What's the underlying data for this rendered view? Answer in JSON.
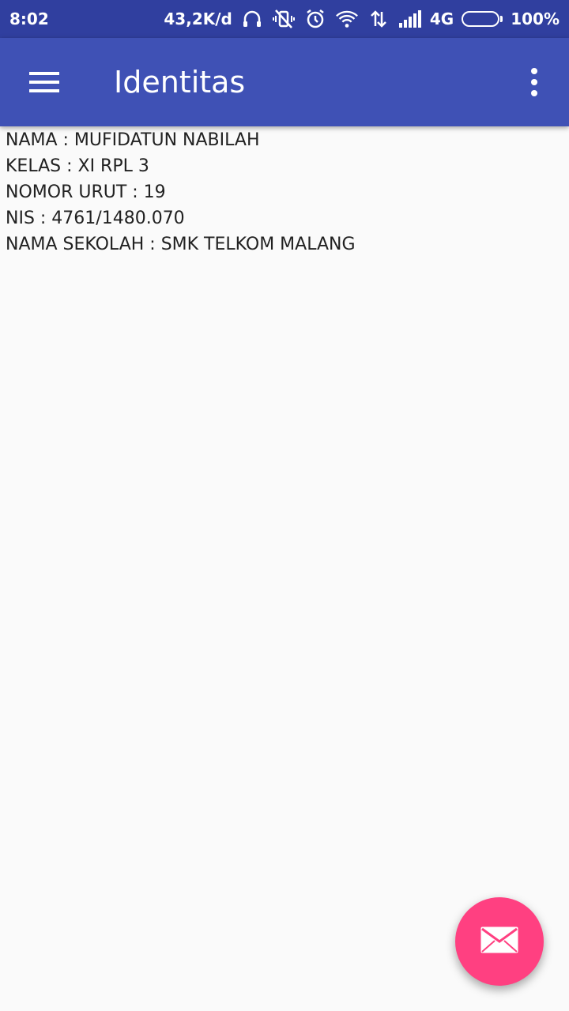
{
  "status_bar": {
    "time": "8:02",
    "net_speed": "43,2K/d",
    "network_type": "4G",
    "battery": "100%",
    "battery_level": 1.0,
    "icons": [
      "headset-icon",
      "vibrate-off-icon",
      "alarm-icon",
      "wifi-icon",
      "data-arrows-icon",
      "signal-icon",
      "battery-icon"
    ]
  },
  "app_bar": {
    "title": "Identitas",
    "menu_icon": "hamburger-menu-icon",
    "overflow_icon": "more-vert-icon",
    "background": "#3f51b5"
  },
  "content": {
    "lines": [
      "NAMA : MUFIDATUN NABILAH",
      "KELAS : XI RPL 3",
      "NOMOR URUT : 19",
      "NIS : 4761/1480.070",
      "NAMA SEKOLAH : SMK TELKOM MALANG"
    ]
  },
  "fab": {
    "icon": "mail-icon",
    "color": "#ff4081"
  }
}
